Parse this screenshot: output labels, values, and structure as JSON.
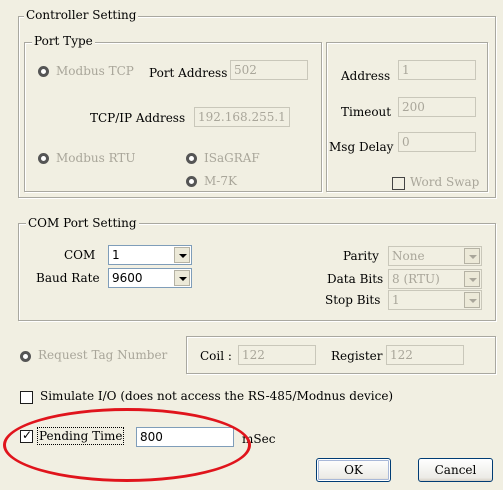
{
  "controller": {
    "legend": "Controller Setting",
    "port_type": {
      "legend": "Port Type",
      "modbus_tcp": "Modbus TCP",
      "port_address_label": "Port Address",
      "port_address": "502",
      "tcpip_label": "TCP/IP Address",
      "tcpip": "192.168.255.1",
      "modbus_rtu": "Modbus RTU",
      "isagraf": "ISaGRAF",
      "m7k": "M-7K"
    },
    "right": {
      "address_label": "Address",
      "address": "1",
      "timeout_label": "Timeout",
      "timeout": "200",
      "msg_delay_label": "Msg Delay",
      "msg_delay": "0",
      "word_swap": "Word Swap"
    }
  },
  "com": {
    "legend": "COM Port Setting",
    "com_label": "COM",
    "com_value": "1",
    "baud_label": "Baud Rate",
    "baud_value": "9600",
    "parity_label": "Parity",
    "parity_value": "None",
    "databits_label": "Data Bits",
    "databits_value": "8 (RTU)",
    "stopbits_label": "Stop Bits",
    "stopbits_value": "1"
  },
  "request": {
    "label": "Request Tag Number",
    "coil_label": "Coil :",
    "coil_value": "122",
    "register_label": "Register",
    "register_value": "122"
  },
  "simulate": {
    "label": "Simulate I/O (does not access the RS-485/Modnus device)",
    "checked": false
  },
  "pending": {
    "label": "Pending Time",
    "checked": true,
    "mark": "✓",
    "value": "800",
    "unit": "mSec"
  },
  "buttons": {
    "ok": "OK",
    "cancel": "Cancel"
  },
  "highlight_color": "#e0141c"
}
